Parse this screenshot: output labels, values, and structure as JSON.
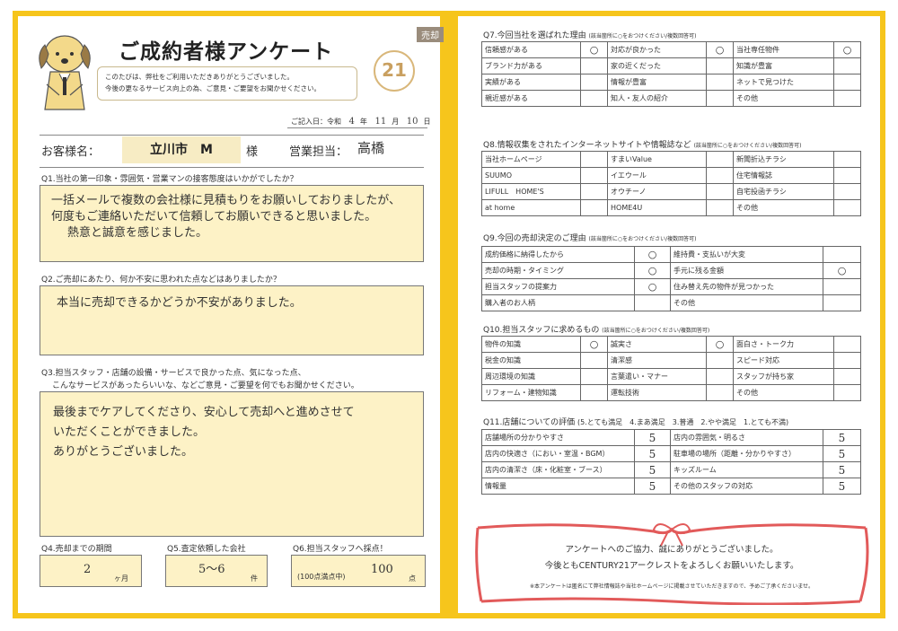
{
  "header": {
    "tag": "売却",
    "title": "ご成約者様アンケート",
    "intro_line1": "このたびは、弊社をご利用いただきありがとうございました。",
    "intro_line2": "今後の更なるサービス向上の為、ご意見・ご要望をお聞かせください。",
    "logo_text": "21",
    "date_label": "ご記入日：令和",
    "date_year": "4",
    "date_year_unit": "年",
    "date_month": "11",
    "date_month_unit": "月",
    "date_day": "10",
    "date_day_unit": "日"
  },
  "customer": {
    "label": "お客様名：",
    "name": "立川市　M",
    "suffix": "様",
    "staff_label": "営業担当：",
    "staff_name": "高橋"
  },
  "q1": {
    "question": "Q1.当社の第一印象・雰囲気・営業マンの接客態度はいかがでしたか？",
    "answer_lines": [
      "一括メールで複数の会社様に見積もりをお願いしておりましたが、",
      "何度もご連絡いただいて信頼してお願いできると思いました。",
      "熱意と誠意を感じました。"
    ]
  },
  "q2": {
    "question": "Q2.ご売却にあたり、何か不安に思われた点などはありましたか？",
    "answer_lines": [
      "本当に売却できるかどうか不安がありました。"
    ]
  },
  "q3": {
    "question_line1": "Q3.担当スタッフ・店舗の設備・サービスで良かった点、気になった点、",
    "question_line2": "こんなサービスがあったらいいな、などご意見・ご要望を何でもお聞かせください。",
    "answer_lines": [
      "最後までケアしてくださり、安心して売却へと進めさせて",
      "いただくことができました。",
      "ありがとうございました。"
    ]
  },
  "q4": {
    "label": "Q4.売却までの期間",
    "value": "2",
    "unit": "ヶ月"
  },
  "q5": {
    "label": "Q5.査定依頼した会社",
    "value": "5〜6",
    "unit": "件"
  },
  "q6": {
    "label": "Q6.担当スタッフへ採点！",
    "prefix": "(100点満点中)",
    "value": "100",
    "unit": "点"
  },
  "q7": {
    "title": "Q7.今回当社を選ばれた理由",
    "note": "(該当箇所に○をおつけください/複数回答可)",
    "rows": [
      [
        {
          "t": "信頼感がある",
          "m": "○"
        },
        {
          "t": "対応が良かった",
          "m": "○"
        },
        {
          "t": "当社専任物件",
          "m": "○"
        }
      ],
      [
        {
          "t": "ブランド力がある",
          "m": ""
        },
        {
          "t": "家の近くだった",
          "m": ""
        },
        {
          "t": "知識が豊富",
          "m": ""
        }
      ],
      [
        {
          "t": "実績がある",
          "m": ""
        },
        {
          "t": "情報が豊富",
          "m": ""
        },
        {
          "t": "ネットで見つけた",
          "m": ""
        }
      ],
      [
        {
          "t": "親近感がある",
          "m": ""
        },
        {
          "t": "知人・友人の紹介",
          "m": ""
        },
        {
          "t": "その他",
          "m": ""
        }
      ]
    ]
  },
  "q8": {
    "title": "Q8.情報収集をされたインターネットサイトや情報誌など",
    "note": "(該当箇所に○をおつけください/複数回答可)",
    "rows": [
      [
        {
          "t": "当社ホームページ",
          "m": ""
        },
        {
          "t": "すまいValue",
          "m": ""
        },
        {
          "t": "新聞折込チラシ",
          "m": ""
        }
      ],
      [
        {
          "t": "SUUMO",
          "m": ""
        },
        {
          "t": "イエウール",
          "m": ""
        },
        {
          "t": "住宅情報誌",
          "m": ""
        }
      ],
      [
        {
          "t": "LIFULL　HOME'S",
          "m": ""
        },
        {
          "t": "オウチーノ",
          "m": ""
        },
        {
          "t": "自宅投函チラシ",
          "m": ""
        }
      ],
      [
        {
          "t": "at home",
          "m": ""
        },
        {
          "t": "HOME4U",
          "m": ""
        },
        {
          "t": "その他",
          "m": ""
        }
      ]
    ]
  },
  "q9": {
    "title": "Q9.今回の売却決定のご理由",
    "note": "(該当箇所に○をおつけください/複数回答可)",
    "rows": [
      [
        {
          "t": "成約価格に納得したから",
          "m": "○"
        },
        {
          "t": "維持費・支払いが大変",
          "m": ""
        }
      ],
      [
        {
          "t": "売却の時期・タイミング",
          "m": "○"
        },
        {
          "t": "手元に残る金額",
          "m": "○"
        }
      ],
      [
        {
          "t": "担当スタッフの提案力",
          "m": "○"
        },
        {
          "t": "住み替え先の物件が見つかった",
          "m": ""
        }
      ],
      [
        {
          "t": "購入者のお人柄",
          "m": ""
        },
        {
          "t": "その他",
          "m": ""
        }
      ]
    ]
  },
  "q10": {
    "title": "Q10.担当スタッフに求めるもの",
    "note": "(該当箇所に○をおつけください/複数回答可)",
    "rows": [
      [
        {
          "t": "物件の知識",
          "m": "○"
        },
        {
          "t": "誠実さ",
          "m": "○"
        },
        {
          "t": "面白さ・トーク力",
          "m": ""
        }
      ],
      [
        {
          "t": "税金の知識",
          "m": ""
        },
        {
          "t": "清潔感",
          "m": ""
        },
        {
          "t": "スピード対応",
          "m": ""
        }
      ],
      [
        {
          "t": "周辺環境の知識",
          "m": ""
        },
        {
          "t": "言葉遣い・マナー",
          "m": ""
        },
        {
          "t": "スタッフが持ち家",
          "m": ""
        }
      ],
      [
        {
          "t": "リフォーム・建物知識",
          "m": ""
        },
        {
          "t": "運転技術",
          "m": ""
        },
        {
          "t": "その他",
          "m": ""
        }
      ]
    ]
  },
  "q11": {
    "title": "Q11.店舗についての評価",
    "scale": "(5.とても満足　4.まあ満足　3.普通　2.やや満足　1.とても不満)",
    "rows": [
      [
        {
          "t": "店舗場所の分かりやすさ",
          "s": "5"
        },
        {
          "t": "店内の雰囲気・明るさ",
          "s": "5"
        }
      ],
      [
        {
          "t": "店内の快適さ（におい・室温・BGM）",
          "s": "5"
        },
        {
          "t": "駐車場の場所（距離・分かりやすさ）",
          "s": "5"
        }
      ],
      [
        {
          "t": "店内の清潔さ（床・化粧室・ブース）",
          "s": "5"
        },
        {
          "t": "キッズルーム",
          "s": "5"
        }
      ],
      [
        {
          "t": "情報量",
          "s": "5"
        },
        {
          "t": "その他のスタッフの対応",
          "s": "5"
        }
      ]
    ]
  },
  "thanks": {
    "line1": "アンケートへのご協力、誠にありがとうございました。",
    "line2": "今後ともCENTURY21アークレストをよろしくお願いいたします。",
    "note": "※本アンケートは匿名にて弊社情報誌や当社ホームページに掲載させていただきますので、予めご了承くださいませ。"
  },
  "colors": {
    "frame": "#f6c51c",
    "answer_bg": "#fdf2c6",
    "ribbon": "#e25a5a"
  }
}
